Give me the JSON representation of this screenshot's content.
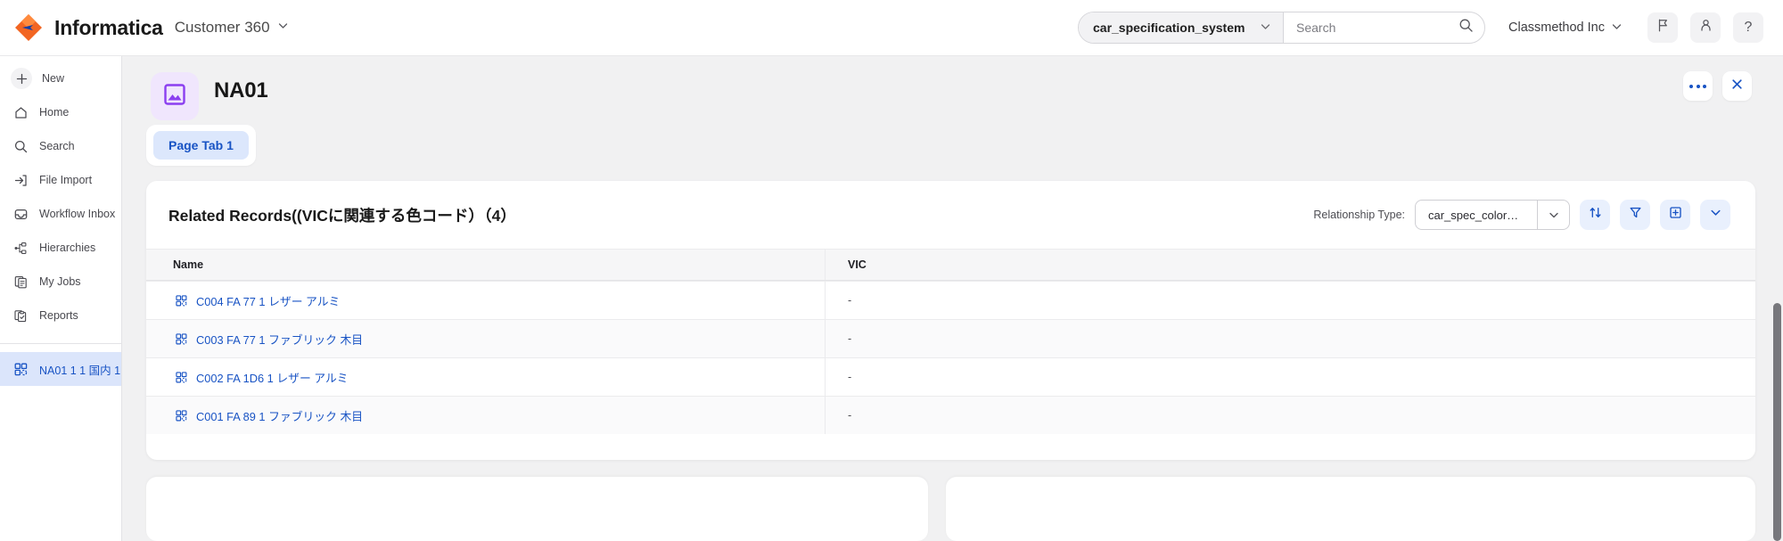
{
  "header": {
    "brand_name": "Informatica",
    "app_name": "Customer 360",
    "app_caret": "⌄",
    "system_selector": {
      "value": "car_specification_system",
      "caret": "⌄"
    },
    "search": {
      "placeholder": "Search",
      "value": "",
      "icon": "search-icon"
    },
    "org": {
      "name": "Classmethod Inc",
      "caret": "⌄"
    },
    "icons": [
      {
        "name": "flag-icon"
      },
      {
        "name": "user-icon"
      },
      {
        "name": "help-icon",
        "glyph": "?"
      }
    ]
  },
  "sidebar": {
    "items": [
      {
        "label": "New",
        "icon": "plus-icon",
        "active": false
      },
      {
        "label": "Home",
        "icon": "home-icon",
        "active": false
      },
      {
        "label": "Search",
        "icon": "search-icon",
        "active": false
      },
      {
        "label": "File Import",
        "icon": "file-import-icon",
        "active": false
      },
      {
        "label": "Workflow Inbox",
        "icon": "inbox-icon",
        "active": false
      },
      {
        "label": "Hierarchies",
        "icon": "hierarchy-icon",
        "active": false
      },
      {
        "label": "My Jobs",
        "icon": "jobs-icon",
        "active": false
      },
      {
        "label": "Reports",
        "icon": "reports-icon",
        "active": false
      }
    ],
    "pinned": {
      "label": "NA01 1 1 国内 1",
      "icon": "record-grid-icon",
      "active": true
    }
  },
  "record": {
    "title": "NA01",
    "avatar_icon": "image-placeholder-icon",
    "actions": [
      {
        "name": "more-options-button",
        "icon": "ellipsis-icon"
      },
      {
        "name": "close-button",
        "icon": "close-icon",
        "glyph": "✕"
      }
    ],
    "tabs": [
      {
        "label": "Page Tab 1",
        "active": true
      }
    ]
  },
  "related_records": {
    "title": "Related Records((VICに関連する色コード）（4）",
    "relationship_type_label": "Relationship Type:",
    "relationship_type_value": "car_spec_color_relati…",
    "relationship_caret": "⌄",
    "tools": [
      {
        "name": "sort-button",
        "icon": "sort-arrows-icon"
      },
      {
        "name": "filter-button",
        "icon": "filter-icon"
      },
      {
        "name": "add-button",
        "icon": "add-box-icon"
      },
      {
        "name": "expand-button",
        "icon": "chevron-down-icon"
      }
    ],
    "columns": [
      "Name",
      "VIC"
    ],
    "rows": [
      {
        "name": "C004 FA 77 1 レザー アルミ",
        "vic": "-"
      },
      {
        "name": "C003 FA 77 1 ファブリック 木目",
        "vic": "-"
      },
      {
        "name": "C002 FA 1D6 1 レザー アルミ",
        "vic": "-"
      },
      {
        "name": "C001 FA 89 1 ファブリック 木目",
        "vic": "-"
      }
    ]
  },
  "colors": {
    "accent_blue": "#1853c4",
    "accent_blue_bg": "#e9f0fd",
    "avatar_purple": "#8b3ff0",
    "avatar_purple_bg": "#f0e6fd",
    "canvas_bg": "#f1f1f2",
    "brand_orange": "#f26522"
  }
}
